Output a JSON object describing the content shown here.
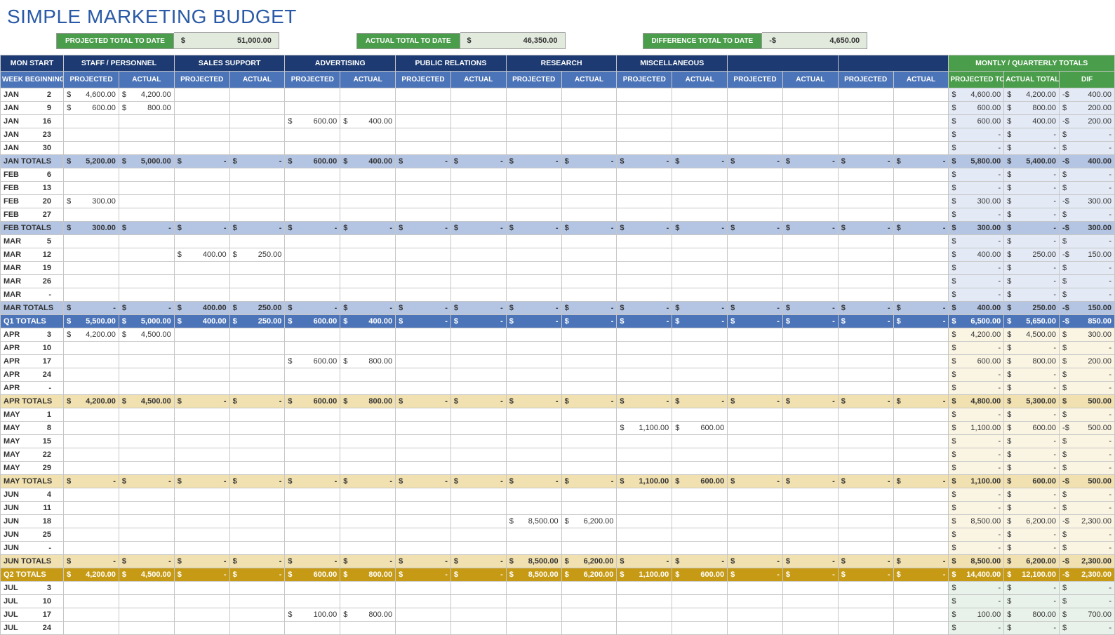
{
  "title": "SIMPLE MARKETING BUDGET",
  "summary": {
    "projected": {
      "label": "PROJECTED TOTAL TO DATE",
      "cur": "$",
      "amt": "51,000.00"
    },
    "actual": {
      "label": "ACTUAL TOTAL TO DATE",
      "cur": "$",
      "amt": "46,350.00"
    },
    "diff": {
      "label": "DIFFERENCE TOTAL TO DATE",
      "cur": "-$",
      "amt": "4,650.00"
    }
  },
  "headers": {
    "monstart": "MON START",
    "weekbeg": "WEEK BEGINNING",
    "groups": [
      "STAFF / PERSONNEL",
      "SALES SUPPORT",
      "ADVERTISING",
      "PUBLIC RELATIONS",
      "RESEARCH",
      "MISCELLANEOUS",
      "",
      ""
    ],
    "sub": {
      "proj": "PROJECTED",
      "act": "ACTUAL"
    },
    "totalsGroup": "MONTLY / QUARTERLY TOTALS",
    "totals": {
      "proj": "PROJECTED TOTALS",
      "act": "ACTUAL TOTALS",
      "dif": "DIF"
    }
  },
  "chart_data": {
    "type": "table",
    "note": "Budget rows. 'cells' array has 16 entries (8 category groups × proj/actual). 'totals' has proj/actual/dif. Values shown as '$|amount' or '-$|amount' or '$|-' for zero dash or '' for blank.",
    "rows": [
      {
        "type": "w",
        "q": 1,
        "mon": "JAN",
        "day": "2",
        "cells": [
          "$|4,600.00",
          "$|4,200.00",
          "",
          "",
          "",
          "",
          "",
          "",
          "",
          "",
          "",
          "",
          "",
          "",
          "",
          ""
        ],
        "totals": [
          "$|4,600.00",
          "$|4,200.00",
          "-$|400.00"
        ]
      },
      {
        "type": "w",
        "q": 1,
        "mon": "JAN",
        "day": "9",
        "cells": [
          "$|600.00",
          "$|800.00",
          "",
          "",
          "",
          "",
          "",
          "",
          "",
          "",
          "",
          "",
          "",
          "",
          "",
          ""
        ],
        "totals": [
          "$|600.00",
          "$|800.00",
          "$|200.00"
        ]
      },
      {
        "type": "w",
        "q": 1,
        "mon": "JAN",
        "day": "16",
        "cells": [
          "",
          "",
          "",
          "",
          "$|600.00",
          "$|400.00",
          "",
          "",
          "",
          "",
          "",
          "",
          "",
          "",
          "",
          ""
        ],
        "totals": [
          "$|600.00",
          "$|400.00",
          "-$|200.00"
        ]
      },
      {
        "type": "w",
        "q": 1,
        "mon": "JAN",
        "day": "23",
        "cells": [
          "",
          "",
          "",
          "",
          "",
          "",
          "",
          "",
          "",
          "",
          "",
          "",
          "",
          "",
          "",
          ""
        ],
        "totals": [
          "$|-",
          "$|-",
          "$|-"
        ]
      },
      {
        "type": "w",
        "q": 1,
        "mon": "JAN",
        "day": "30",
        "cells": [
          "",
          "",
          "",
          "",
          "",
          "",
          "",
          "",
          "",
          "",
          "",
          "",
          "",
          "",
          "",
          ""
        ],
        "totals": [
          "$|-",
          "$|-",
          "$|-"
        ]
      },
      {
        "type": "sub",
        "q": 1,
        "label": "JAN TOTALS",
        "cells": [
          "$|5,200.00",
          "$|5,000.00",
          "$|-",
          "$|-",
          "$|600.00",
          "$|400.00",
          "$|-",
          "$|-",
          "$|-",
          "$|-",
          "$|-",
          "$|-",
          "$|-",
          "$|-",
          "$|-",
          "$|-"
        ],
        "totals": [
          "$|5,800.00",
          "$|5,400.00",
          "-$|400.00"
        ]
      },
      {
        "type": "w",
        "q": 1,
        "mon": "FEB",
        "day": "6",
        "cells": [
          "",
          "",
          "",
          "",
          "",
          "",
          "",
          "",
          "",
          "",
          "",
          "",
          "",
          "",
          "",
          ""
        ],
        "totals": [
          "$|-",
          "$|-",
          "$|-"
        ]
      },
      {
        "type": "w",
        "q": 1,
        "mon": "FEB",
        "day": "13",
        "cells": [
          "",
          "",
          "",
          "",
          "",
          "",
          "",
          "",
          "",
          "",
          "",
          "",
          "",
          "",
          "",
          ""
        ],
        "totals": [
          "$|-",
          "$|-",
          "$|-"
        ]
      },
      {
        "type": "w",
        "q": 1,
        "mon": "FEB",
        "day": "20",
        "cells": [
          "$|300.00",
          "",
          "",
          "",
          "",
          "",
          "",
          "",
          "",
          "",
          "",
          "",
          "",
          "",
          "",
          ""
        ],
        "totals": [
          "$|300.00",
          "$|-",
          "-$|300.00"
        ]
      },
      {
        "type": "w",
        "q": 1,
        "mon": "FEB",
        "day": "27",
        "cells": [
          "",
          "",
          "",
          "",
          "",
          "",
          "",
          "",
          "",
          "",
          "",
          "",
          "",
          "",
          "",
          ""
        ],
        "totals": [
          "$|-",
          "$|-",
          "$|-"
        ]
      },
      {
        "type": "sub",
        "q": 1,
        "label": "FEB TOTALS",
        "cells": [
          "$|300.00",
          "$|-",
          "$|-",
          "$|-",
          "$|-",
          "$|-",
          "$|-",
          "$|-",
          "$|-",
          "$|-",
          "$|-",
          "$|-",
          "$|-",
          "$|-",
          "$|-",
          "$|-"
        ],
        "totals": [
          "$|300.00",
          "$|-",
          "-$|300.00"
        ]
      },
      {
        "type": "w",
        "q": 1,
        "mon": "MAR",
        "day": "5",
        "cells": [
          "",
          "",
          "",
          "",
          "",
          "",
          "",
          "",
          "",
          "",
          "",
          "",
          "",
          "",
          "",
          ""
        ],
        "totals": [
          "$|-",
          "$|-",
          "$|-"
        ]
      },
      {
        "type": "w",
        "q": 1,
        "mon": "MAR",
        "day": "12",
        "cells": [
          "",
          "",
          "$|400.00",
          "$|250.00",
          "",
          "",
          "",
          "",
          "",
          "",
          "",
          "",
          "",
          "",
          "",
          ""
        ],
        "totals": [
          "$|400.00",
          "$|250.00",
          "-$|150.00"
        ]
      },
      {
        "type": "w",
        "q": 1,
        "mon": "MAR",
        "day": "19",
        "cells": [
          "",
          "",
          "",
          "",
          "",
          "",
          "",
          "",
          "",
          "",
          "",
          "",
          "",
          "",
          "",
          ""
        ],
        "totals": [
          "$|-",
          "$|-",
          "$|-"
        ]
      },
      {
        "type": "w",
        "q": 1,
        "mon": "MAR",
        "day": "26",
        "cells": [
          "",
          "",
          "",
          "",
          "",
          "",
          "",
          "",
          "",
          "",
          "",
          "",
          "",
          "",
          "",
          ""
        ],
        "totals": [
          "$|-",
          "$|-",
          "$|-"
        ]
      },
      {
        "type": "w",
        "q": 1,
        "mon": "MAR",
        "day": "-",
        "cells": [
          "",
          "",
          "",
          "",
          "",
          "",
          "",
          "",
          "",
          "",
          "",
          "",
          "",
          "",
          "",
          ""
        ],
        "totals": [
          "$|-",
          "$|-",
          "$|-"
        ]
      },
      {
        "type": "sub",
        "q": 1,
        "label": "MAR TOTALS",
        "cells": [
          "$|-",
          "$|-",
          "$|400.00",
          "$|250.00",
          "$|-",
          "$|-",
          "$|-",
          "$|-",
          "$|-",
          "$|-",
          "$|-",
          "$|-",
          "$|-",
          "$|-",
          "$|-",
          "$|-"
        ],
        "totals": [
          "$|400.00",
          "$|250.00",
          "-$|150.00"
        ]
      },
      {
        "type": "qtr",
        "q": 1,
        "label": "Q1 TOTALS",
        "cells": [
          "$|5,500.00",
          "$|5,000.00",
          "$|400.00",
          "$|250.00",
          "$|600.00",
          "$|400.00",
          "$|-",
          "$|-",
          "$|-",
          "$|-",
          "$|-",
          "$|-",
          "$|-",
          "$|-",
          "$|-",
          "$|-"
        ],
        "totals": [
          "$|6,500.00",
          "$|5,650.00",
          "-$|850.00"
        ]
      },
      {
        "type": "w",
        "q": 2,
        "mon": "APR",
        "day": "3",
        "cells": [
          "$|4,200.00",
          "$|4,500.00",
          "",
          "",
          "",
          "",
          "",
          "",
          "",
          "",
          "",
          "",
          "",
          "",
          "",
          ""
        ],
        "totals": [
          "$|4,200.00",
          "$|4,500.00",
          "$|300.00"
        ]
      },
      {
        "type": "w",
        "q": 2,
        "mon": "APR",
        "day": "10",
        "cells": [
          "",
          "",
          "",
          "",
          "",
          "",
          "",
          "",
          "",
          "",
          "",
          "",
          "",
          "",
          "",
          ""
        ],
        "totals": [
          "$|-",
          "$|-",
          "$|-"
        ]
      },
      {
        "type": "w",
        "q": 2,
        "mon": "APR",
        "day": "17",
        "cells": [
          "",
          "",
          "",
          "",
          "$|600.00",
          "$|800.00",
          "",
          "",
          "",
          "",
          "",
          "",
          "",
          "",
          "",
          ""
        ],
        "totals": [
          "$|600.00",
          "$|800.00",
          "$|200.00"
        ]
      },
      {
        "type": "w",
        "q": 2,
        "mon": "APR",
        "day": "24",
        "cells": [
          "",
          "",
          "",
          "",
          "",
          "",
          "",
          "",
          "",
          "",
          "",
          "",
          "",
          "",
          "",
          ""
        ],
        "totals": [
          "$|-",
          "$|-",
          "$|-"
        ]
      },
      {
        "type": "w",
        "q": 2,
        "mon": "APR",
        "day": "-",
        "cells": [
          "",
          "",
          "",
          "",
          "",
          "",
          "",
          "",
          "",
          "",
          "",
          "",
          "",
          "",
          "",
          ""
        ],
        "totals": [
          "$|-",
          "$|-",
          "$|-"
        ]
      },
      {
        "type": "sub",
        "q": 2,
        "label": "APR TOTALS",
        "cells": [
          "$|4,200.00",
          "$|4,500.00",
          "$|-",
          "$|-",
          "$|600.00",
          "$|800.00",
          "$|-",
          "$|-",
          "$|-",
          "$|-",
          "$|-",
          "$|-",
          "$|-",
          "$|-",
          "$|-",
          "$|-"
        ],
        "totals": [
          "$|4,800.00",
          "$|5,300.00",
          "$|500.00"
        ]
      },
      {
        "type": "w",
        "q": 2,
        "mon": "MAY",
        "day": "1",
        "cells": [
          "",
          "",
          "",
          "",
          "",
          "",
          "",
          "",
          "",
          "",
          "",
          "",
          "",
          "",
          "",
          ""
        ],
        "totals": [
          "$|-",
          "$|-",
          "$|-"
        ]
      },
      {
        "type": "w",
        "q": 2,
        "mon": "MAY",
        "day": "8",
        "cells": [
          "",
          "",
          "",
          "",
          "",
          "",
          "",
          "",
          "",
          "",
          "$|1,100.00",
          "$|600.00",
          "",
          "",
          "",
          ""
        ],
        "totals": [
          "$|1,100.00",
          "$|600.00",
          "-$|500.00"
        ]
      },
      {
        "type": "w",
        "q": 2,
        "mon": "MAY",
        "day": "15",
        "cells": [
          "",
          "",
          "",
          "",
          "",
          "",
          "",
          "",
          "",
          "",
          "",
          "",
          "",
          "",
          "",
          ""
        ],
        "totals": [
          "$|-",
          "$|-",
          "$|-"
        ]
      },
      {
        "type": "w",
        "q": 2,
        "mon": "MAY",
        "day": "22",
        "cells": [
          "",
          "",
          "",
          "",
          "",
          "",
          "",
          "",
          "",
          "",
          "",
          "",
          "",
          "",
          "",
          ""
        ],
        "totals": [
          "$|-",
          "$|-",
          "$|-"
        ]
      },
      {
        "type": "w",
        "q": 2,
        "mon": "MAY",
        "day": "29",
        "cells": [
          "",
          "",
          "",
          "",
          "",
          "",
          "",
          "",
          "",
          "",
          "",
          "",
          "",
          "",
          "",
          ""
        ],
        "totals": [
          "$|-",
          "$|-",
          "$|-"
        ]
      },
      {
        "type": "sub",
        "q": 2,
        "label": "MAY TOTALS",
        "cells": [
          "$|-",
          "$|-",
          "$|-",
          "$|-",
          "$|-",
          "$|-",
          "$|-",
          "$|-",
          "$|-",
          "$|-",
          "$|1,100.00",
          "$|600.00",
          "$|-",
          "$|-",
          "$|-",
          "$|-"
        ],
        "totals": [
          "$|1,100.00",
          "$|600.00",
          "-$|500.00"
        ]
      },
      {
        "type": "w",
        "q": 2,
        "mon": "JUN",
        "day": "4",
        "cells": [
          "",
          "",
          "",
          "",
          "",
          "",
          "",
          "",
          "",
          "",
          "",
          "",
          "",
          "",
          "",
          ""
        ],
        "totals": [
          "$|-",
          "$|-",
          "$|-"
        ]
      },
      {
        "type": "w",
        "q": 2,
        "mon": "JUN",
        "day": "11",
        "cells": [
          "",
          "",
          "",
          "",
          "",
          "",
          "",
          "",
          "",
          "",
          "",
          "",
          "",
          "",
          "",
          ""
        ],
        "totals": [
          "$|-",
          "$|-",
          "$|-"
        ]
      },
      {
        "type": "w",
        "q": 2,
        "mon": "JUN",
        "day": "18",
        "cells": [
          "",
          "",
          "",
          "",
          "",
          "",
          "",
          "",
          "$|8,500.00",
          "$|6,200.00",
          "",
          "",
          "",
          "",
          "",
          ""
        ],
        "totals": [
          "$|8,500.00",
          "$|6,200.00",
          "-$|2,300.00"
        ]
      },
      {
        "type": "w",
        "q": 2,
        "mon": "JUN",
        "day": "25",
        "cells": [
          "",
          "",
          "",
          "",
          "",
          "",
          "",
          "",
          "",
          "",
          "",
          "",
          "",
          "",
          "",
          ""
        ],
        "totals": [
          "$|-",
          "$|-",
          "$|-"
        ]
      },
      {
        "type": "w",
        "q": 2,
        "mon": "JUN",
        "day": "-",
        "cells": [
          "",
          "",
          "",
          "",
          "",
          "",
          "",
          "",
          "",
          "",
          "",
          "",
          "",
          "",
          "",
          ""
        ],
        "totals": [
          "$|-",
          "$|-",
          "$|-"
        ]
      },
      {
        "type": "sub",
        "q": 2,
        "label": "JUN TOTALS",
        "cells": [
          "$|-",
          "$|-",
          "$|-",
          "$|-",
          "$|-",
          "$|-",
          "$|-",
          "$|-",
          "$|8,500.00",
          "$|6,200.00",
          "$|-",
          "$|-",
          "$|-",
          "$|-",
          "$|-",
          "$|-"
        ],
        "totals": [
          "$|8,500.00",
          "$|6,200.00",
          "-$|2,300.00"
        ]
      },
      {
        "type": "qtr",
        "q": 2,
        "label": "Q2 TOTALS",
        "cells": [
          "$|4,200.00",
          "$|4,500.00",
          "$|-",
          "$|-",
          "$|600.00",
          "$|800.00",
          "$|-",
          "$|-",
          "$|8,500.00",
          "$|6,200.00",
          "$|1,100.00",
          "$|600.00",
          "$|-",
          "$|-",
          "$|-",
          "$|-"
        ],
        "totals": [
          "$|14,400.00",
          "$|12,100.00",
          "-$|2,300.00"
        ]
      },
      {
        "type": "w",
        "q": 3,
        "mon": "JUL",
        "day": "3",
        "cells": [
          "",
          "",
          "",
          "",
          "",
          "",
          "",
          "",
          "",
          "",
          "",
          "",
          "",
          "",
          "",
          ""
        ],
        "totals": [
          "$|-",
          "$|-",
          "$|-"
        ]
      },
      {
        "type": "w",
        "q": 3,
        "mon": "JUL",
        "day": "10",
        "cells": [
          "",
          "",
          "",
          "",
          "",
          "",
          "",
          "",
          "",
          "",
          "",
          "",
          "",
          "",
          "",
          ""
        ],
        "totals": [
          "$|-",
          "$|-",
          "$|-"
        ]
      },
      {
        "type": "w",
        "q": 3,
        "mon": "JUL",
        "day": "17",
        "cells": [
          "",
          "",
          "",
          "",
          "$|100.00",
          "$|800.00",
          "",
          "",
          "",
          "",
          "",
          "",
          "",
          "",
          "",
          ""
        ],
        "totals": [
          "$|100.00",
          "$|800.00",
          "$|700.00"
        ]
      },
      {
        "type": "w",
        "q": 3,
        "mon": "JUL",
        "day": "24",
        "cells": [
          "",
          "",
          "",
          "",
          "",
          "",
          "",
          "",
          "",
          "",
          "",
          "",
          "",
          "",
          "",
          ""
        ],
        "totals": [
          "$|-",
          "$|-",
          "$|-"
        ]
      }
    ]
  }
}
